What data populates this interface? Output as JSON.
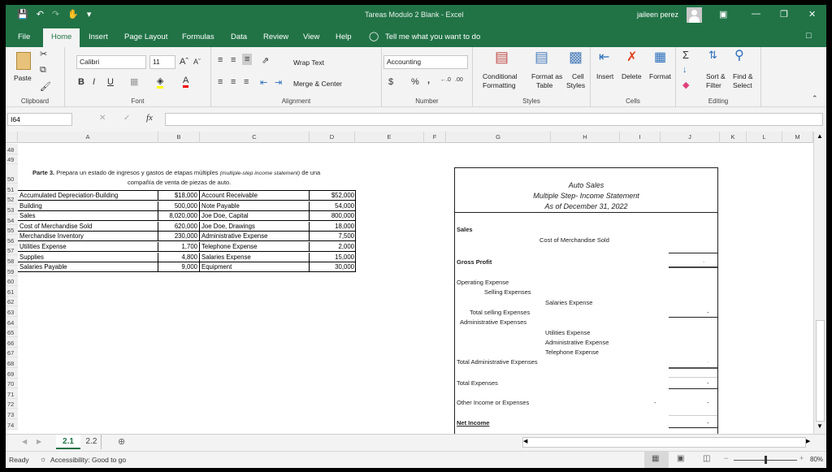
{
  "titlebar": {
    "title": "Tareas Modulo 2 Blank  -  Excel",
    "user": "jaileen perez",
    "qat": [
      "save-icon",
      "undo-icon",
      "redo-icon",
      "touch-mode-icon",
      "customize-icon"
    ]
  },
  "tabs": [
    "File",
    "Home",
    "Insert",
    "Page Layout",
    "Formulas",
    "Data",
    "Review",
    "View",
    "Help"
  ],
  "tell_me": "Tell me what you want to do",
  "ribbon": {
    "clipboard": {
      "paste": "Paste",
      "label": "Clipboard"
    },
    "font": {
      "name": "Calibri",
      "size": "11",
      "label": "Font",
      "bold": "B",
      "italic": "I",
      "underline": "U"
    },
    "alignment": {
      "wrap": "Wrap Text",
      "merge": "Merge & Center",
      "label": "Alignment"
    },
    "number": {
      "format": "Accounting",
      "label": "Number",
      "currency": "$",
      "percent": "%",
      "comma": ","
    },
    "styles": {
      "conditional": "Conditional",
      "conditional2": "Formatting",
      "table": "Format as",
      "table2": "Table",
      "cell": "Cell",
      "cell2": "Styles",
      "label": "Styles"
    },
    "cells": {
      "insert": "Insert",
      "delete": "Delete",
      "format": "Format",
      "label": "Cells"
    },
    "editing": {
      "sort": "Sort &",
      "sort2": "Filter",
      "find": "Find &",
      "find2": "Select",
      "label": "Editing"
    }
  },
  "namebox": "I64",
  "formula": "",
  "columns": [
    "A",
    "B",
    "C",
    "D",
    "E",
    "F",
    "G",
    "H",
    "I",
    "J",
    "K",
    "L",
    "M"
  ],
  "rows": [
    "48",
    "49",
    "50",
    "51",
    "52",
    "53",
    "54",
    "55",
    "56",
    "57",
    "58",
    "59",
    "60",
    "61",
    "62",
    "63",
    "64",
    "65",
    "66",
    "67",
    "68",
    "69",
    "70",
    "71",
    "72",
    "73",
    "74"
  ],
  "instructions": {
    "bold": "Parte 3.",
    "text": "Prepara un estado de ingresos y gastos de etapas múltiples",
    "italic": "(multiple-step income statement)",
    "end": "de una",
    "line2": "compañía de venta de piezas de auto."
  },
  "accounts": [
    {
      "a": "Accumulated Depreciation-Building",
      "b": "$18,000",
      "c": "Account Receivable",
      "d": "$52,000"
    },
    {
      "a": "Building",
      "b": "500,000",
      "c": "Note Payable",
      "d": "54,000"
    },
    {
      "a": "Sales",
      "b": "8,020,000",
      "c": "Joe Doe, Capital",
      "d": "800,000"
    },
    {
      "a": "Cost of Merchandise Sold",
      "b": "620,000",
      "c": "Joe Doe, Drawings",
      "d": "18,000"
    },
    {
      "a": "Merchandise Inventory",
      "b": "230,000",
      "c": "Administrative Expense",
      "d": "7,500"
    },
    {
      "a": "Utilities Expense",
      "b": "1,700",
      "c": "Telephone Expense",
      "d": "2,000"
    },
    {
      "a": "Supplies",
      "b": "4,800",
      "c": "Salaries Expense",
      "d": "15,000"
    },
    {
      "a": "Salaries Payable",
      "b": "9,000",
      "c": "Equipment",
      "d": "30,000"
    }
  ],
  "statement": {
    "company": "Auto Sales",
    "title": "Multiple Step- Income Statement",
    "date": "As of December 31, 2022",
    "sales": "Sales",
    "cogs": "Cost of Merchandise Sold",
    "gross_profit": "Gross Profit",
    "gross_profit_value": "-",
    "operating": "Operating Expense",
    "selling": "Selling Expenses",
    "salaries": "Salaries Expense",
    "total_selling": "Total selling Expenses",
    "total_selling_value": "-",
    "admin": "Administrative Expenses",
    "utilities": "Utilities Expense",
    "admin_expense": "Administrative Expense",
    "telephone": "Telephone Expense",
    "total_admin": "Total Administrative Expenses",
    "total_admin_value": "-",
    "total_expenses": "Total  Expenses",
    "total_expenses_value": "-",
    "other": "Other Income or Expenses",
    "other_value_1": "-",
    "other_value_2": "-",
    "net_income": "Net Income",
    "net_income_value": "-"
  },
  "sheets": [
    "2.1",
    "2.2"
  ],
  "active_sheet": "2.1",
  "status": {
    "ready": "Ready",
    "accessibility": "Accessibility: Good to go",
    "zoom": "80%",
    "zoom_fraction": 0.5
  }
}
